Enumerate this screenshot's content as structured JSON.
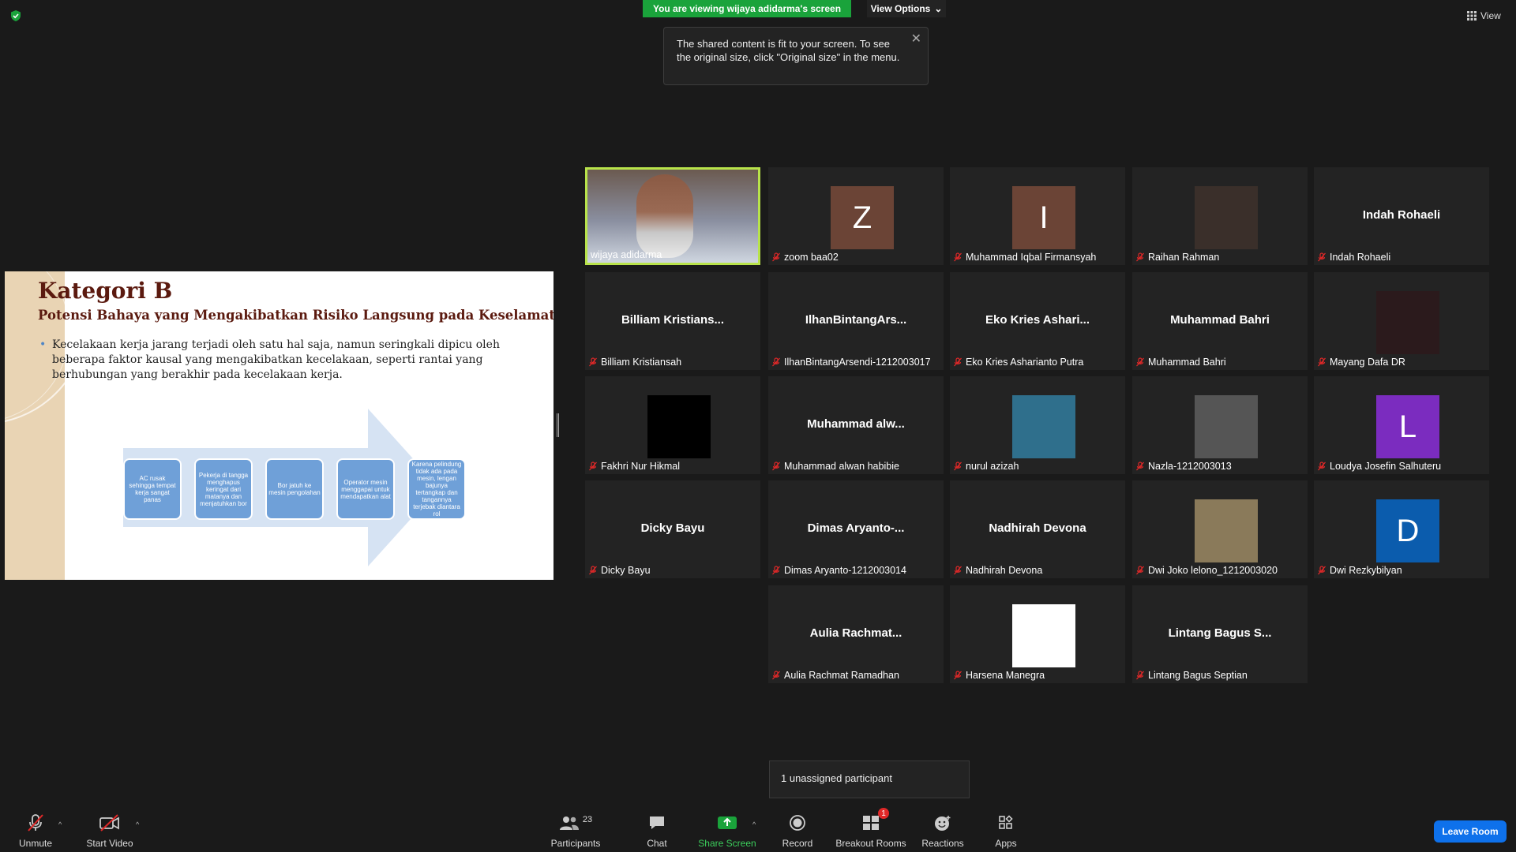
{
  "top": {
    "viewing_banner": "You are viewing wijaya adidarma's screen",
    "view_options": "View Options",
    "view_label": "View",
    "tooltip": "The shared content is fit to your screen. To see the original size, click \"Original size\" in the menu."
  },
  "slide": {
    "title": "Kategori B",
    "subtitle": "Potensi Bahaya yang Mengakibatkan Risiko Langsung pada Keselamatan",
    "bullet": "Kecelakaan kerja jarang terjadi oleh satu hal saja, namun seringkali dipicu oleh beberapa faktor kausal yang mengakibatkan kecelakaan, seperti rantai yang berhubungan yang berakhir pada kecelakaan kerja.",
    "flow": [
      "AC rusak sehingga tempat kerja sangat panas",
      "Pekerja di tangga menghapus keringat dari matanya dan menjatuhkan bor",
      "Bor jatuh ke mesin pengolahan",
      "Operator mesin menggapai untuk mendapatkan alat",
      "Karena pelindung tidak ada pada mesin, lengan bajunya tertangkap dan tangannya terjebak diantara rol"
    ]
  },
  "participants": [
    {
      "name": "wijaya adidarma",
      "type": "video",
      "active": true
    },
    {
      "name": "zoom baa02",
      "type": "letter",
      "letter": "Z",
      "color": "#6b4436"
    },
    {
      "name": "Muhammad Iqbal Firmansyah",
      "type": "letter",
      "letter": "I",
      "color": "#6b4436"
    },
    {
      "name": "Raihan Rahman",
      "type": "photo"
    },
    {
      "name": "Indah Rohaeli",
      "type": "text",
      "big": "Indah Rohaeli"
    },
    {
      "name": "Billiam Kristiansah",
      "type": "text",
      "big": "Billiam  Kristians..."
    },
    {
      "name": "IlhanBintangArsendi-1212003017",
      "type": "text",
      "big": "IlhanBintangArs..."
    },
    {
      "name": "Eko Kries Asharianto Putra",
      "type": "text",
      "big": "Eko  Kries  Ashari..."
    },
    {
      "name": "Muhammad Bahri",
      "type": "text",
      "big": "Muhammad Bahri"
    },
    {
      "name": "Mayang Dafa DR",
      "type": "photo"
    },
    {
      "name": "Fakhri Nur Hikmal",
      "type": "photo"
    },
    {
      "name": "Muhammad alwan habibie",
      "type": "text",
      "big": "Muhammad  alw..."
    },
    {
      "name": "nurul azizah",
      "type": "photo"
    },
    {
      "name": "Nazla-1212003013",
      "type": "photo"
    },
    {
      "name": "Loudya Josefin Salhuteru",
      "type": "letter",
      "letter": "L",
      "color": "#7b2cbf"
    },
    {
      "name": "Dicky Bayu",
      "type": "text",
      "big": "Dicky Bayu"
    },
    {
      "name": "Dimas Aryanto-1212003014",
      "type": "text",
      "big": "Dimas  Aryanto-..."
    },
    {
      "name": "Nadhirah Devona",
      "type": "text",
      "big": "Nadhirah Devona"
    },
    {
      "name": "Dwi Joko lelono_1212003020",
      "type": "photo"
    },
    {
      "name": "Dwi Rezkybilyan",
      "type": "letter",
      "letter": "D",
      "color": "#0b5cad"
    },
    {
      "name": "Aulia Rachmat Ramadhan",
      "type": "text",
      "big": "Aulia  Rachmat..."
    },
    {
      "name": "Harsena Manegra",
      "type": "photo"
    },
    {
      "name": "Lintang Bagus Septian",
      "type": "text",
      "big": "Lintang Bagus S..."
    }
  ],
  "unassigned": "1 unassigned participant",
  "toolbar": {
    "unmute": "Unmute",
    "start_video": "Start Video",
    "participants": "Participants",
    "participants_count": "23",
    "chat": "Chat",
    "share_screen": "Share Screen",
    "record": "Record",
    "breakout_rooms": "Breakout Rooms",
    "breakout_badge": "1",
    "reactions": "Reactions",
    "apps": "Apps",
    "leave": "Leave Room"
  },
  "colors": {
    "active_border": "#b8e34a",
    "share_green": "#1aa33b",
    "leave_blue": "#0e71eb",
    "slide_title": "#5b1a0f",
    "flow_box": "#6fa0d8"
  }
}
